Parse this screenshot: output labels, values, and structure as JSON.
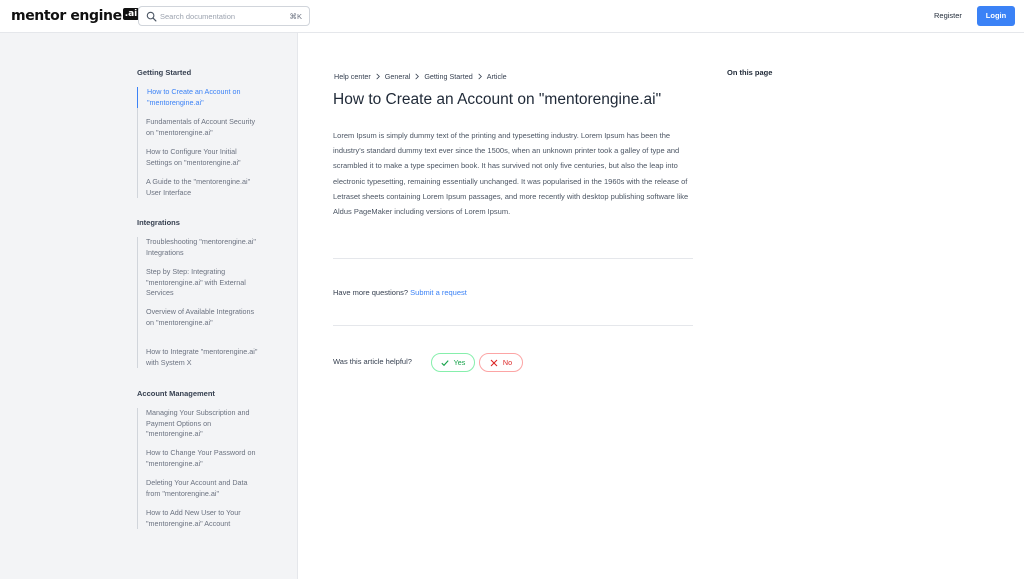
{
  "header": {
    "logo_text": "mentor engine",
    "logo_badge": ".ai",
    "search_placeholder": "Search documentation",
    "search_shortcut": "⌘K",
    "register_label": "Register",
    "login_label": "Login"
  },
  "sidebar": {
    "sections": [
      {
        "title": "Getting Started",
        "items": [
          {
            "label": "How to Create an Account on \"mentorengine.ai\"",
            "active": true
          },
          {
            "label": "Fundamentals of Account Security on \"mentorengine.ai\""
          },
          {
            "label": "How to Configure Your Initial Settings on \"mentorengine.ai\""
          },
          {
            "label": "A Guide to the \"mentorengine.ai\" User Interface"
          }
        ]
      },
      {
        "title": "Integrations",
        "items": [
          {
            "label": "Troubleshooting \"mentorengine.ai\" Integrations"
          },
          {
            "label": "Step by Step: Integrating \"mentorengine.ai\" with External Services"
          },
          {
            "label": "Overview of Available Integrations on \"mentorengine.ai\""
          },
          {
            "label": "How to Integrate \"mentorengine.ai\" with System X"
          }
        ]
      },
      {
        "title": "Account Management",
        "items": [
          {
            "label": "Managing Your Subscription and Payment Options on \"mentorengine.ai\""
          },
          {
            "label": "How to Change Your Password on \"mentorengine.ai\""
          },
          {
            "label": "Deleting Your Account and Data from \"mentorengine.ai\""
          },
          {
            "label": "How to Add New User to Your \"mentorengine.ai\" Account"
          }
        ]
      }
    ]
  },
  "breadcrumb": [
    "Help center",
    "General",
    "Getting Started",
    "Article"
  ],
  "article": {
    "title": "How to Create an Account on \"mentorengine.ai\"",
    "body": "Lorem Ipsum is simply dummy text of the printing and typesetting industry. Lorem Ipsum has been the industry's standard dummy text ever since the 1500s, when an unknown printer took a galley of type and scrambled it to make a type specimen book. It has survived not only five centuries, but also the leap into electronic typesetting, remaining essentially unchanged. It was popularised in the 1960s with the release of Letraset sheets containing Lorem Ipsum passages, and more recently with desktop publishing software like Aldus PageMaker including versions of Lorem Ipsum."
  },
  "questions": {
    "prompt": "Have more questions?",
    "link_label": "Submit a request"
  },
  "feedback": {
    "prompt": "Was this article helpful?",
    "yes_label": "Yes",
    "no_label": "No"
  },
  "toc": {
    "title": "On this page"
  },
  "colors": {
    "accent": "#3b82f6",
    "sidebar_bg": "#f3f4f6",
    "yes": "#16a34a",
    "no": "#dc2626"
  }
}
